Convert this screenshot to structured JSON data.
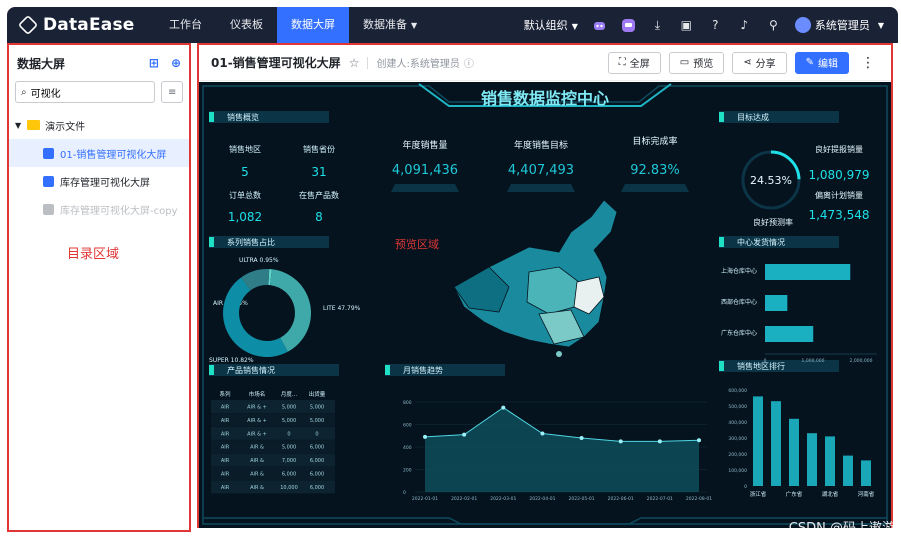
{
  "app": {
    "brand": "DataEase"
  },
  "nav": [
    {
      "label": "工作台"
    },
    {
      "label": "仪表板"
    },
    {
      "label": "数据大屏"
    },
    {
      "label": "数据准备"
    }
  ],
  "topbar": {
    "org": "默认组织",
    "user": "系统管理员"
  },
  "sidebar": {
    "title": "数据大屏",
    "search_value": "可视化",
    "folder": "演示文件",
    "items": [
      {
        "label": "01-销售管理可视化大屏"
      },
      {
        "label": "库存管理可视化大屏"
      },
      {
        "label": "库存管理可视化大屏-copy"
      }
    ],
    "annotation": "目录区域"
  },
  "main": {
    "title": "01-销售管理可视化大屏",
    "creator": "创建人:系统管理员",
    "buttons": {
      "fullscreen": "全屏",
      "preview": "预览",
      "share": "分享",
      "edit": "编辑"
    },
    "annotation": "预览区域"
  },
  "screen": {
    "title": "销售数据监控中心",
    "sales_overview": {
      "title": "销售概览",
      "labels": [
        "销售地区",
        "销售省份",
        "订单总数",
        "在售产品数"
      ],
      "values": [
        "5",
        "31",
        "1,082",
        "8"
      ]
    },
    "kpis": [
      {
        "label": "年度销售量",
        "value": "4,091,436"
      },
      {
        "label": "年度销售目标",
        "value": "4,407,493"
      },
      {
        "label": "目标完成率",
        "value": "92.83%"
      }
    ],
    "target": {
      "title": "目标达成",
      "ring_value": "24.53%",
      "ring_label": "良好预测率",
      "good_label": "良好提报销量",
      "good_value": "1,080,979",
      "plan_label": "偏离计划销量",
      "plan_value": "1,473,548"
    },
    "series_share": {
      "title": "系列销售占比",
      "slices": [
        {
          "name": "ULTRA",
          "pct": 0.95,
          "label": "ULTRA 0.95%"
        },
        {
          "name": "AIR",
          "pct": 40.45,
          "label": "AIR 40.45%"
        },
        {
          "name": "LITE",
          "pct": 47.79,
          "label": "LITE 47.79%"
        },
        {
          "name": "SUPER",
          "pct": 10.82,
          "label": "SUPER 10.82%"
        }
      ]
    },
    "center_shipping": {
      "title": "中心发货情况",
      "bars": [
        {
          "label": "上海仓库中心",
          "value": 1450000
        },
        {
          "label": "西部仓库中心",
          "value": 380000
        },
        {
          "label": "广东仓库中心",
          "value": 820000
        }
      ],
      "ticks": [
        "0",
        "1,000,000",
        "2,000,000"
      ]
    },
    "product_sales": {
      "title": "产品销售情况",
      "headers": [
        "系列",
        "市场名",
        "月度...",
        "出货量"
      ],
      "rows": [
        [
          "AIR",
          "AIR & +",
          "5,000",
          "5,000"
        ],
        [
          "AIR",
          "AIR & +",
          "5,000",
          "5,000"
        ],
        [
          "AIR",
          "AIR & +",
          "0",
          "0"
        ],
        [
          "AIR",
          "AIR &",
          "5,000",
          "6,000"
        ],
        [
          "AIR",
          "AIR &",
          "7,000",
          "6,000"
        ],
        [
          "AIR",
          "AIR &",
          "6,000",
          "6,000"
        ],
        [
          "AIR",
          "AIR &",
          "10,000",
          "6,000"
        ]
      ]
    },
    "monthly_trend": {
      "title": "月销售趋势",
      "x": [
        "2022-01-01",
        "2022-02-01",
        "2022-03-01",
        "2022-04-01",
        "2022-05-01",
        "2022-06-01",
        "2022-07-01",
        "2022-08-01"
      ],
      "y": [
        490,
        510,
        750,
        520,
        480,
        450,
        450,
        460
      ],
      "yticks": [
        "800",
        "600",
        "400",
        "200",
        "0"
      ]
    },
    "region_rank": {
      "title": "销售地区排行",
      "categories": [
        "浙江省",
        "",
        "广东省",
        "",
        "湖北省",
        "",
        "河南省"
      ],
      "values": [
        560000,
        530000,
        420000,
        330000,
        310000,
        190000,
        160000
      ],
      "yticks": [
        "600,000",
        "500,000",
        "400,000",
        "300,000",
        "200,000",
        "100,000",
        "0"
      ]
    }
  },
  "watermark": "CSDN @码上遨游",
  "colors": {
    "accent": "#3370ff",
    "annotation": "#e03636",
    "screen_bg": "#04131e",
    "teal": "#1fb5c4"
  }
}
